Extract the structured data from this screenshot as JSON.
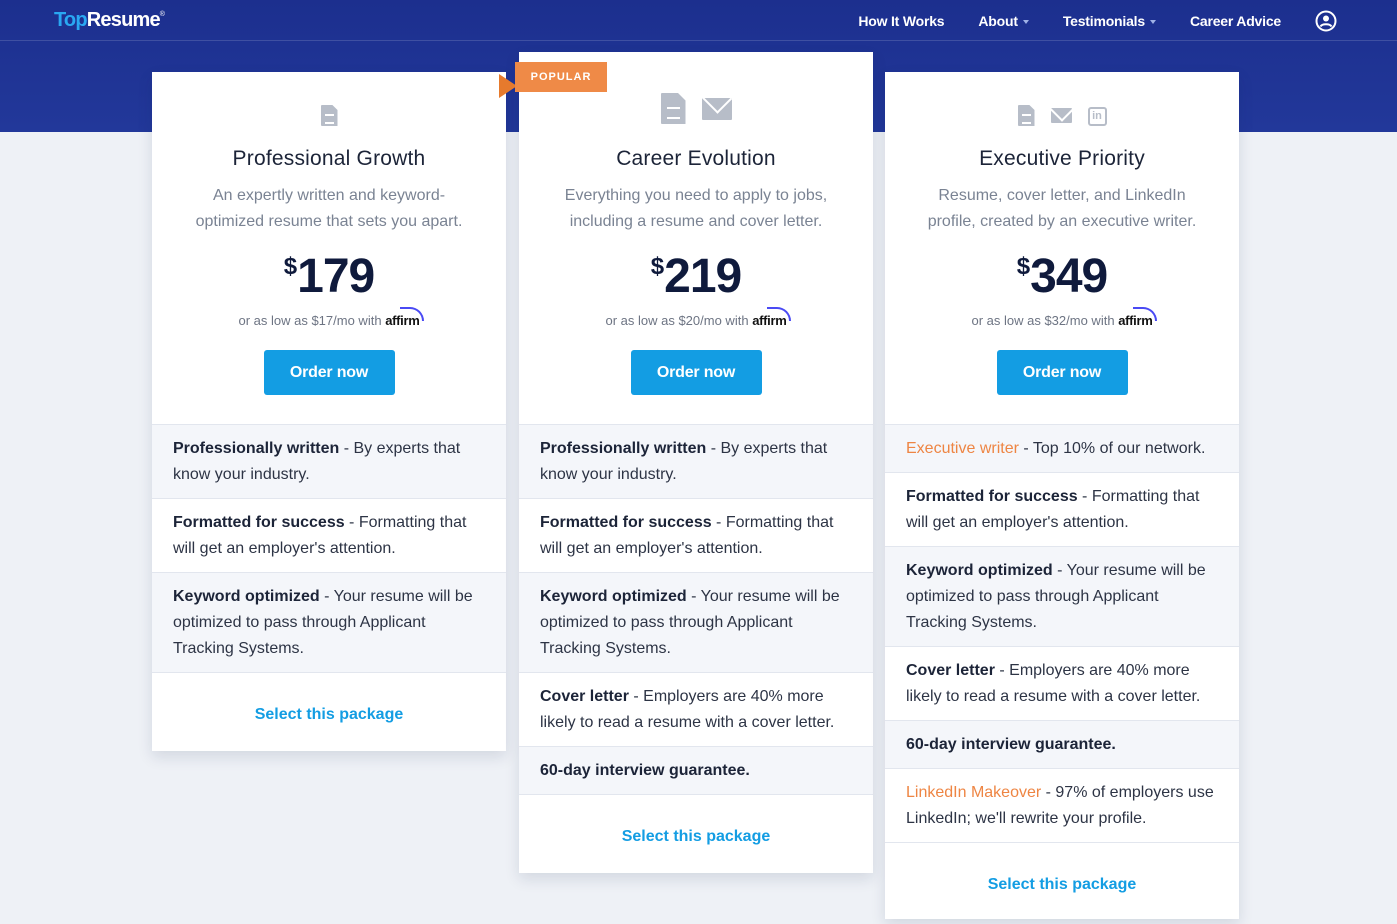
{
  "nav": {
    "logo_top": "Top",
    "logo_resume": "Resume",
    "logo_reg": "®",
    "links": [
      {
        "label": "How It Works",
        "has_caret": false
      },
      {
        "label": "About",
        "has_caret": true
      },
      {
        "label": "Testimonials",
        "has_caret": true
      },
      {
        "label": "Career Advice",
        "has_caret": false
      }
    ],
    "account_icon": "user-circle-icon"
  },
  "plans": [
    {
      "name": "Professional Growth",
      "icons": [
        "document-icon"
      ],
      "description": "An expertly written and keyword-optimized resume that sets you apart.",
      "currency": "$",
      "price": "179",
      "affirm_text": "or as low as $17/mo with",
      "affirm_brand": "affirm",
      "order_label": "Order now",
      "features": [
        {
          "highlight": "Professionally written",
          "text": " - By experts that know your industry."
        },
        {
          "highlight": "Formatted for success",
          "text": " - Formatting that will get an employer's attention."
        },
        {
          "highlight": "Keyword optimized",
          "text": " - Your resume will be optimized to pass through Applicant Tracking Systems."
        }
      ],
      "select_label": "Select this package"
    },
    {
      "name": "Career Evolution",
      "badge": "POPULAR",
      "icons": [
        "document-icon",
        "mail-icon"
      ],
      "description": "Everything you need to apply to jobs, including a resume and cover letter.",
      "currency": "$",
      "price": "219",
      "affirm_text": "or as low as $20/mo with",
      "affirm_brand": "affirm",
      "order_label": "Order now",
      "features": [
        {
          "highlight": "Professionally written",
          "text": " - By experts that know your industry."
        },
        {
          "highlight": "Formatted for success",
          "text": " - Formatting that will get an employer's attention."
        },
        {
          "highlight": "Keyword optimized",
          "text": " - Your resume will be optimized to pass through Applicant Tracking Systems."
        },
        {
          "highlight": "Cover letter",
          "text": " - Employers are 40% more likely to read a resume with a cover letter."
        },
        {
          "highlight": "60-day interview guarantee.",
          "text": ""
        }
      ],
      "select_label": "Select this package"
    },
    {
      "name": "Executive Priority",
      "icons": [
        "document-icon",
        "mail-icon",
        "linkedin-icon"
      ],
      "description": "Resume, cover letter, and LinkedIn profile, created by an executive writer.",
      "currency": "$",
      "price": "349",
      "affirm_text": "or as low as $32/mo with",
      "affirm_brand": "affirm",
      "order_label": "Order now",
      "features": [
        {
          "highlight": "Executive writer",
          "text": " - Top 10% of our network.",
          "accent": true
        },
        {
          "highlight": "Formatted for success",
          "text": " - Formatting that will get an employer's attention."
        },
        {
          "highlight": "Keyword optimized",
          "text": " - Your resume will be optimized to pass through Applicant Tracking Systems."
        },
        {
          "highlight": "Cover letter",
          "text": " - Employers are 40% more likely to read a resume with a cover letter."
        },
        {
          "highlight": "60-day interview guarantee.",
          "text": ""
        },
        {
          "highlight": "LinkedIn Makeover",
          "text": " - 97% of employers use LinkedIn; we'll rewrite your profile.",
          "accent": true
        }
      ],
      "select_label": "Select this package"
    }
  ],
  "colors": {
    "nav_bg": "#1c2f8e",
    "primary_button": "#139de3",
    "accent_orange": "#ee8543",
    "page_bg": "#eef1f6"
  }
}
